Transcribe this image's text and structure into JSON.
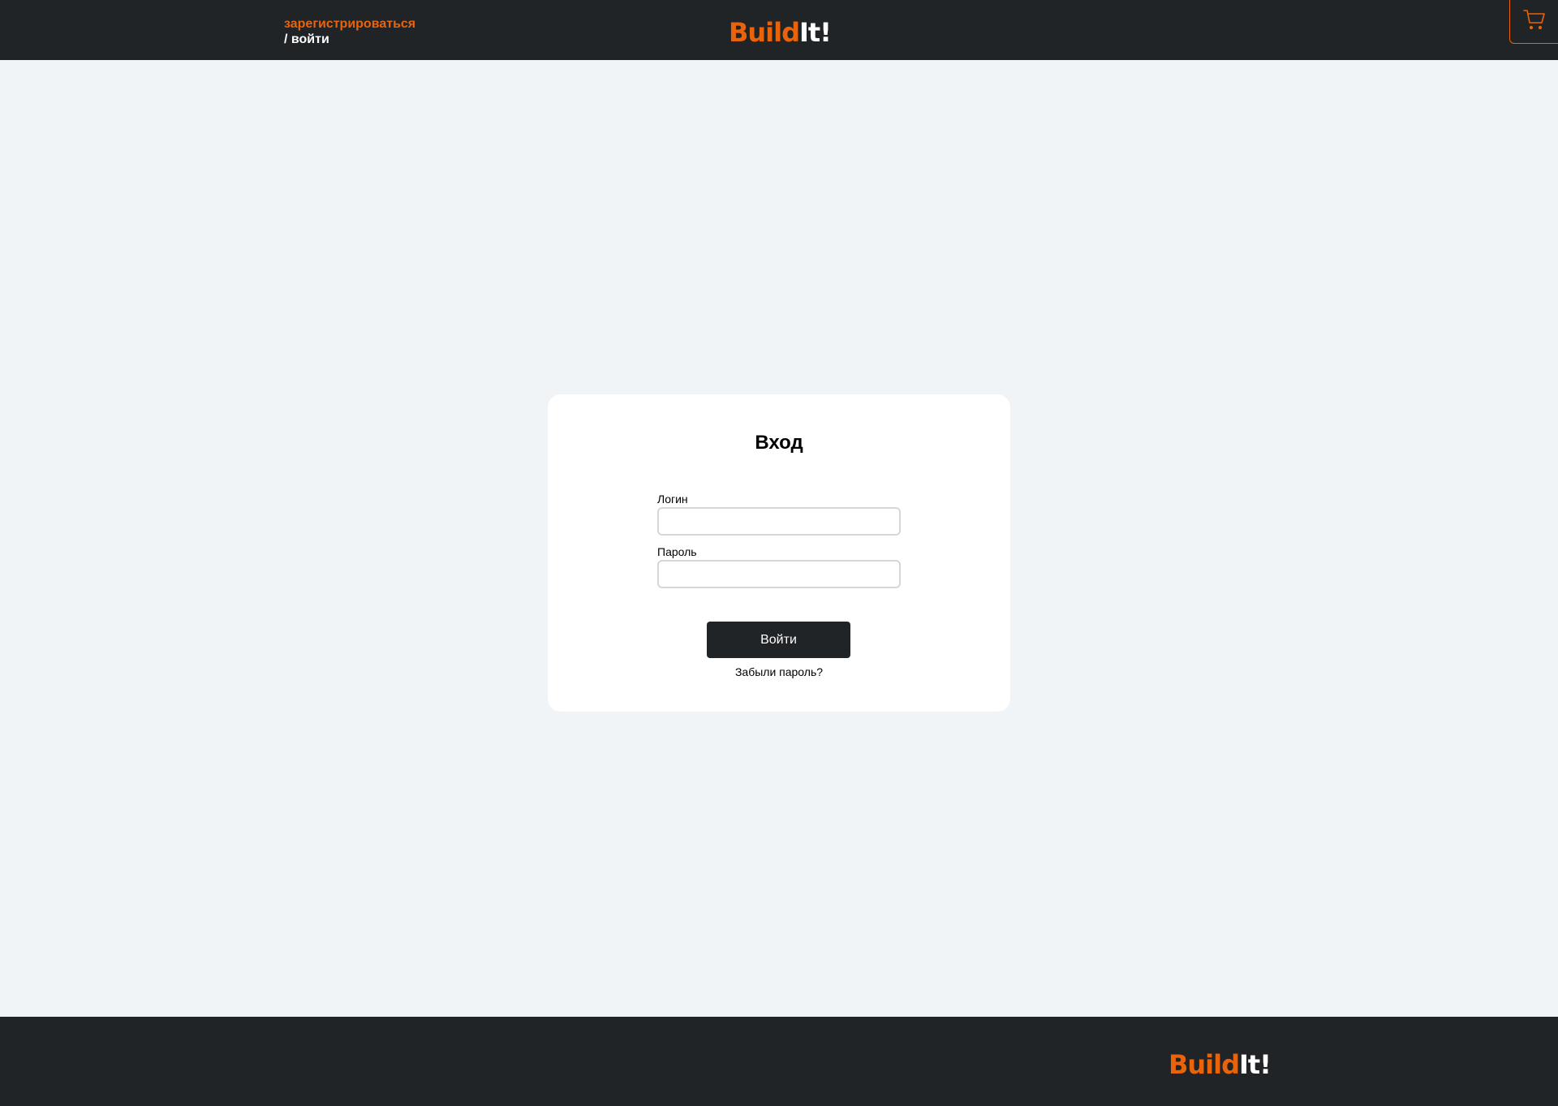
{
  "header": {
    "register_label": "зарегистрироваться",
    "login_label": "/ войти",
    "logo_part1": "Build",
    "logo_part2": "It!",
    "cart_icon": "cart-icon"
  },
  "login_form": {
    "title": "Вход",
    "login_label": "Логин",
    "login_value": "",
    "password_label": "Пароль",
    "password_value": "",
    "submit_label": "Войти",
    "forgot_password_label": "Забыли пароль?"
  },
  "footer": {
    "logo_part1": "Build",
    "logo_part2": "It!"
  },
  "colors": {
    "accent": "#e8630a",
    "dark": "#212426",
    "background": "#f0f4f7",
    "card": "#ffffff"
  }
}
